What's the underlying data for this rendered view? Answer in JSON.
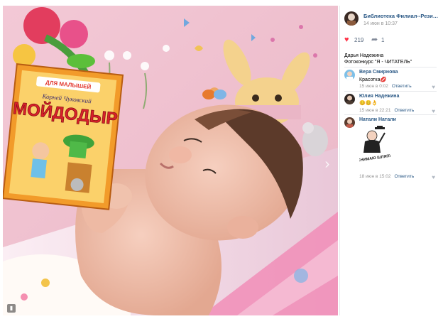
{
  "post": {
    "group_name": "Библиотека Филиал--Резинотехни...",
    "date": "14 июн в 10:37",
    "likes": "219",
    "shares": "1",
    "author": "Дарья Надежина",
    "description": "Фотоконкурс \"Я - ЧИТАТЕЛЬ\""
  },
  "photo": {
    "book_series": "ДЛЯ МАЛЫШЕЙ",
    "book_author": "Корней Чуковский",
    "book_title": "МОЙДОДЫР"
  },
  "comments": [
    {
      "author": "Вера Смирнова",
      "text": "Красотка💋",
      "time": "15 июн в 0:02",
      "reply": "Ответить"
    },
    {
      "author": "Юлия Надежина",
      "text": "😊😊👌",
      "time": "15 июн в 22:21",
      "reply": "Ответить"
    },
    {
      "author": "Натали Натали",
      "sticker_caption": "СНИМАЮ ШЛЯПУ",
      "time": "18 июн в 15:02",
      "reply": "Ответить"
    }
  ],
  "icons": {
    "like": "heart-icon",
    "share": "share-icon",
    "next": "chevron-right-icon",
    "comment_like": "heart-outline-icon"
  },
  "colors": {
    "link": "#2a5885",
    "heart": "#ff3347",
    "meta": "#939393"
  }
}
